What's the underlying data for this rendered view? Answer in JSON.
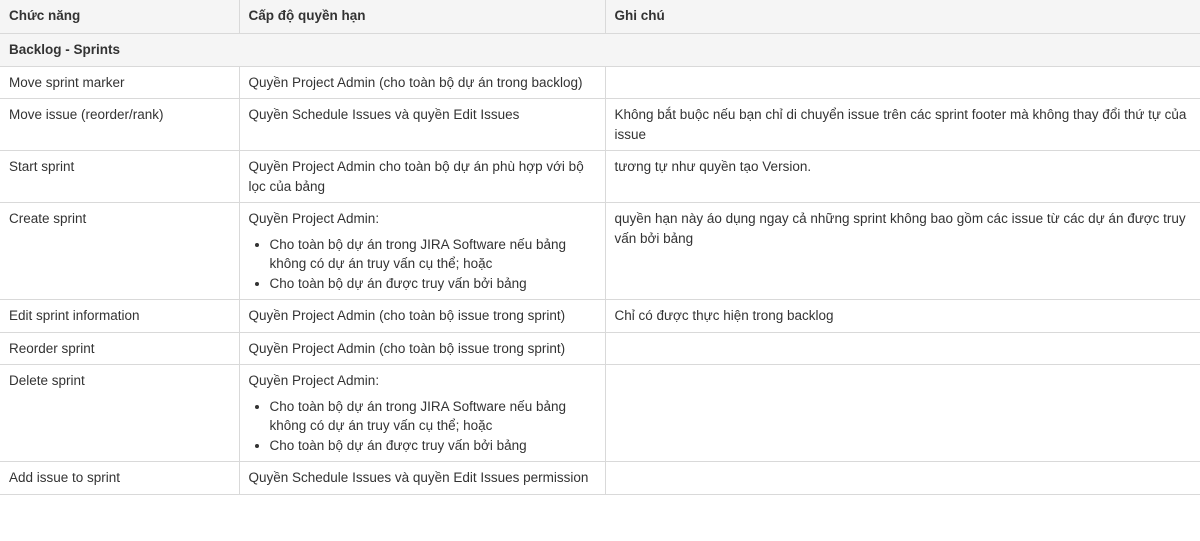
{
  "table": {
    "headers": [
      "Chức năng",
      "Cấp độ quyền hạn",
      "Ghi chú"
    ],
    "section_title": "Backlog - Sprints",
    "rows": [
      {
        "function": "Move sprint marker",
        "permission": "Quyền Project Admin (cho toàn bộ dự án trong backlog)",
        "permission_items": [],
        "note": ""
      },
      {
        "function": "Move issue (reorder/rank)",
        "permission": "Quyền Schedule Issues và quyền Edit Issues",
        "permission_items": [],
        "note": "Không bắt buộc nếu bạn chỉ di chuyển issue trên các sprint footer mà không thay đổi thứ tự của issue"
      },
      {
        "function": "Start sprint",
        "permission": "Quyền Project Admin cho toàn bộ dự án phù hợp với bộ lọc của bảng",
        "permission_items": [],
        "note": "tương tự như quyền tạo Version."
      },
      {
        "function": "Create sprint",
        "permission": "Quyền Project Admin:",
        "permission_items": [
          "Cho toàn bộ dự án trong JIRA Software nếu bảng không có dự án truy vấn cụ thể; hoặc",
          "Cho toàn bộ dự án được truy vấn bởi bảng"
        ],
        "note": "quyền hạn này áo dụng ngay cả những sprint không bao gồm các issue từ các dự án được truy vấn bởi bảng"
      },
      {
        "function": "Edit sprint information",
        "permission": "Quyền Project Admin (cho toàn bộ issue trong sprint)",
        "permission_items": [],
        "note": "Chỉ có được thực hiện trong backlog"
      },
      {
        "function": "Reorder sprint",
        "permission": "Quyền Project Admin (cho toàn bộ issue trong sprint)",
        "permission_items": [],
        "note": ""
      },
      {
        "function": "Delete sprint",
        "permission": "Quyền Project Admin:",
        "permission_items": [
          "Cho toàn bộ dự án trong JIRA Software nếu bảng không có dự án truy vấn cụ thể; hoặc",
          "Cho toàn bộ dự án được truy vấn bởi bảng"
        ],
        "note": ""
      },
      {
        "function": "Add issue to sprint",
        "permission": "Quyền Schedule Issues và quyền Edit Issues permission",
        "permission_items": [],
        "note": ""
      }
    ]
  },
  "colors": {
    "header_bg": "#f5f5f5",
    "border": "#d9d9d9",
    "text": "#333333"
  }
}
